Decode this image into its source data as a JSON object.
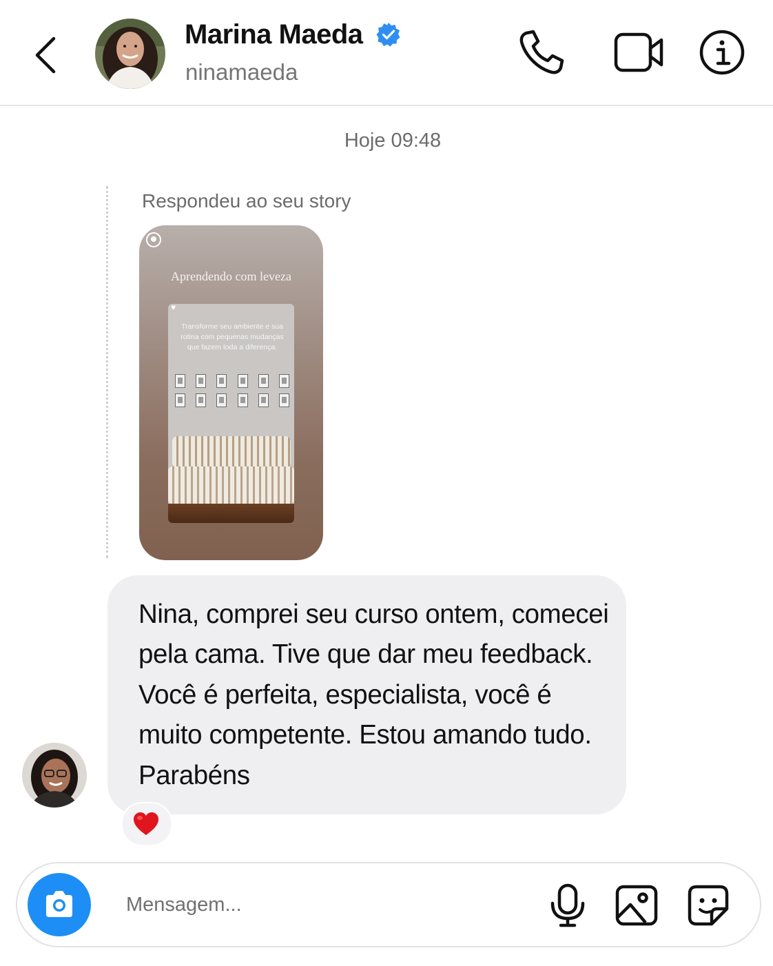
{
  "header": {
    "contact_name": "Marina Maeda",
    "username": "ninamaeda",
    "verified": true,
    "icons": [
      "back-arrow-icon",
      "phone-icon",
      "video-camera-icon",
      "info-icon"
    ]
  },
  "chat": {
    "timestamp": "Hoje 09:48",
    "story_reply_label": "Respondeu ao seu story",
    "story": {
      "title": "Aprendendo com leveza",
      "text": "Transforme seu ambiente e sua rotina com pequenas mudanças que fazem toda a diferença."
    },
    "message": {
      "text": "Nina, comprei seu curso ontem, comecei pela cama. Tive que dar meu feedback. Você é perfeita, especialista, você é muito competente. Estou amando tudo. Parabéns",
      "reaction": "❤️"
    }
  },
  "composer": {
    "placeholder": "Mensagem...",
    "icons": [
      "camera-icon",
      "microphone-icon",
      "gallery-icon",
      "sticker-icon"
    ]
  },
  "colors": {
    "accent": "#1d8ef5",
    "bubble": "#efeff1",
    "verified": "#2f8ff0",
    "reaction": "#e0151d"
  }
}
